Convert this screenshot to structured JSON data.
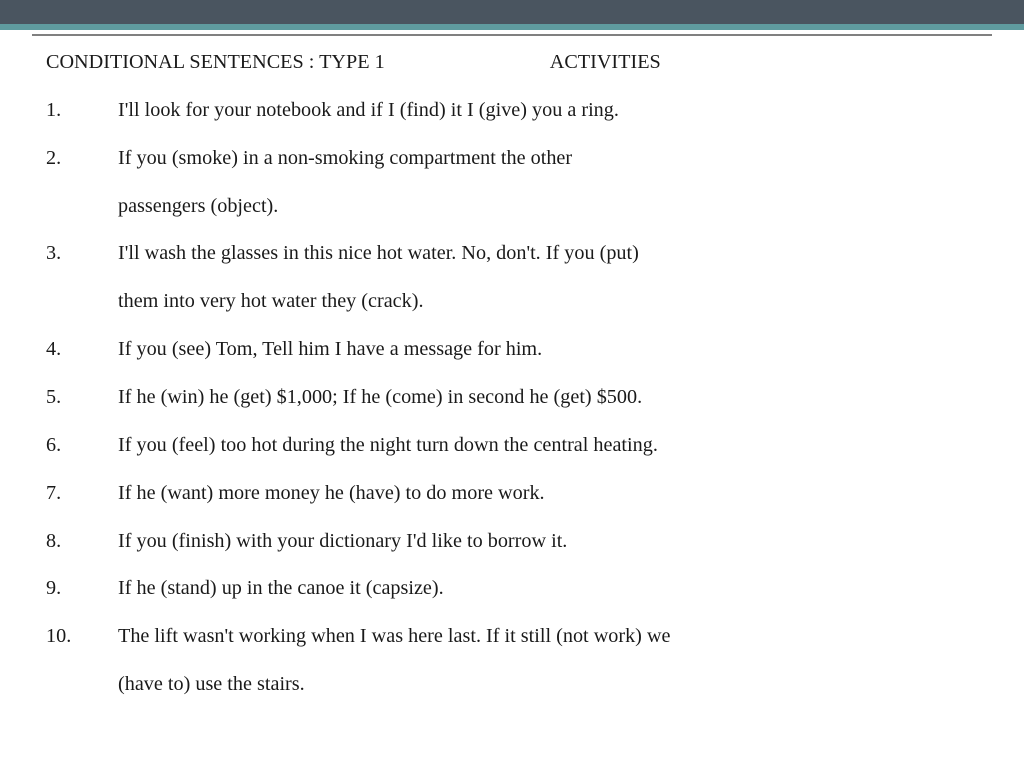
{
  "heading": "CONDITIONAL SENTENCES : TYPE 1",
  "activities_label": "ACTIVITIES",
  "items": [
    {
      "n": "1.",
      "lines": [
        "I'll look for your notebook and if I (find) it I (give) you a ring."
      ]
    },
    {
      "n": "2.",
      "lines": [
        "If you (smoke) in a non-smoking compartment the other",
        "passengers (object)."
      ]
    },
    {
      "n": "3.",
      "lines": [
        "I'll wash the glasses in this nice hot water. No, don't. If you (put)",
        "them into very hot water they (crack)."
      ]
    },
    {
      "n": "4.",
      "lines": [
        "If you (see) Tom, Tell him I have a message for him."
      ]
    },
    {
      "n": "5.",
      "lines": [
        "If he (win) he (get) $1,000; If he (come) in second he (get) $500."
      ]
    },
    {
      "n": "6.",
      "lines": [
        "If you (feel) too hot during the night turn down the central heating."
      ]
    },
    {
      "n": "7.",
      "lines": [
        "If he (want) more money he (have) to do more work."
      ]
    },
    {
      "n": "8.",
      "lines": [
        "If you (finish) with your dictionary I'd like to borrow it."
      ]
    },
    {
      "n": "9.",
      "lines": [
        "If he (stand) up in the canoe it (capsize)."
      ]
    },
    {
      "n": "10.",
      "lines": [
        "The lift wasn't working when I was here last. If it still (not work) we",
        "(have to) use the stairs."
      ]
    }
  ]
}
